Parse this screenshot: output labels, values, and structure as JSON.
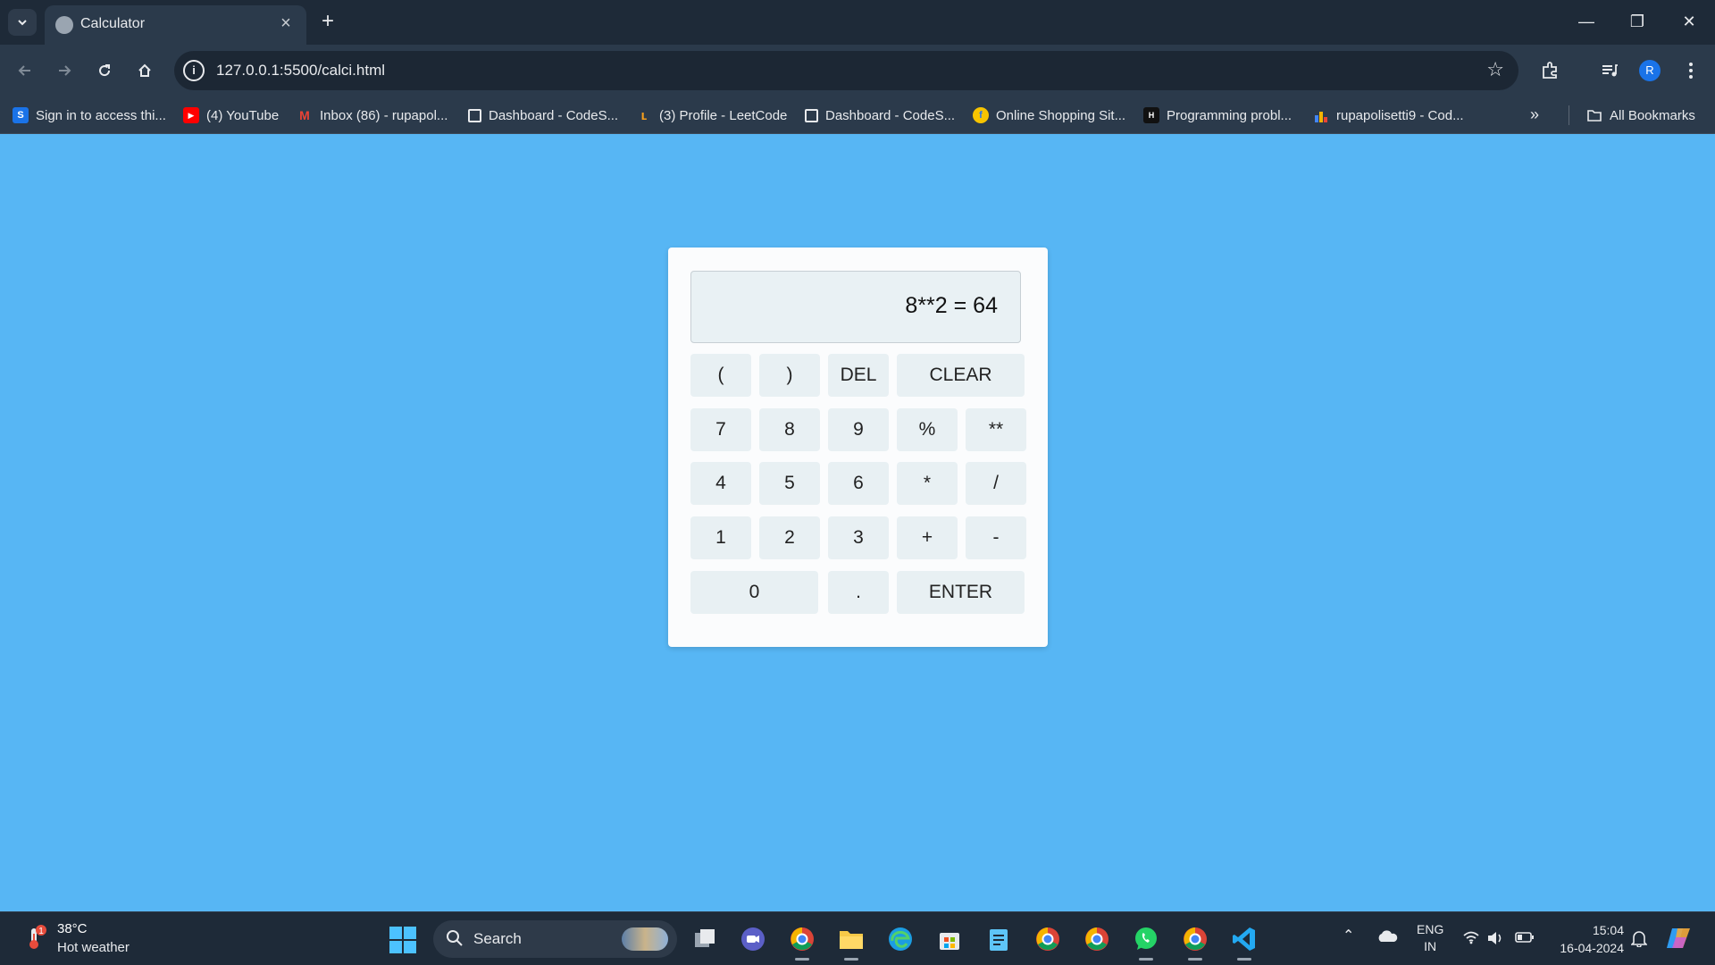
{
  "browser": {
    "tab": {
      "title": "Calculator"
    },
    "address": {
      "url": "127.0.0.1:5500/calci.html"
    },
    "profile_initial": "R",
    "bookmarks": [
      {
        "label": "Sign in to access thi...",
        "icon": "s-icon",
        "color": "#1a73e8",
        "glyph": "S"
      },
      {
        "label": "(4) YouTube",
        "icon": "youtube-icon",
        "color": "#ff0000",
        "glyph": "▶"
      },
      {
        "label": "Inbox (86) - rupapol...",
        "icon": "gmail-icon",
        "color": "#ea4335",
        "glyph": "M"
      },
      {
        "label": "Dashboard - CodeS...",
        "icon": "page-icon",
        "color": "",
        "glyph": ""
      },
      {
        "label": "(3) Profile - LeetCode",
        "icon": "leetcode-icon",
        "color": "#f89f1b",
        "glyph": "ʟ"
      },
      {
        "label": "Dashboard - CodeS...",
        "icon": "page-icon",
        "color": "",
        "glyph": ""
      },
      {
        "label": "Online Shopping Sit...",
        "icon": "flipkart-icon",
        "color": "#f7c400",
        "glyph": "f"
      },
      {
        "label": "Programming probl...",
        "icon": "hackerearth-icon",
        "color": "#111111",
        "glyph": "H"
      },
      {
        "label": "rupapolisetti9 - Cod...",
        "icon": "chart-icon",
        "color": "#f4b400",
        "glyph": "▮"
      }
    ],
    "all_bookmarks_label": "All Bookmarks"
  },
  "calculator": {
    "display": "8**2 = 64",
    "keys": {
      "open_paren": "(",
      "close_paren": ")",
      "del": "DEL",
      "clear": "CLEAR",
      "k7": "7",
      "k8": "8",
      "k9": "9",
      "percent": "%",
      "power": "**",
      "k4": "4",
      "k5": "5",
      "k6": "6",
      "multiply": "*",
      "divide": "/",
      "k1": "1",
      "k2": "2",
      "k3": "3",
      "plus": "+",
      "minus": "-",
      "k0": "0",
      "dot": ".",
      "enter": "ENTER"
    }
  },
  "taskbar": {
    "weather": {
      "temp": "38°C",
      "desc": "Hot weather",
      "badge": "1"
    },
    "search_label": "Search",
    "lang": {
      "line1": "ENG",
      "line2": "IN"
    },
    "clock": {
      "time": "15:04",
      "date": "16-04-2024"
    }
  }
}
